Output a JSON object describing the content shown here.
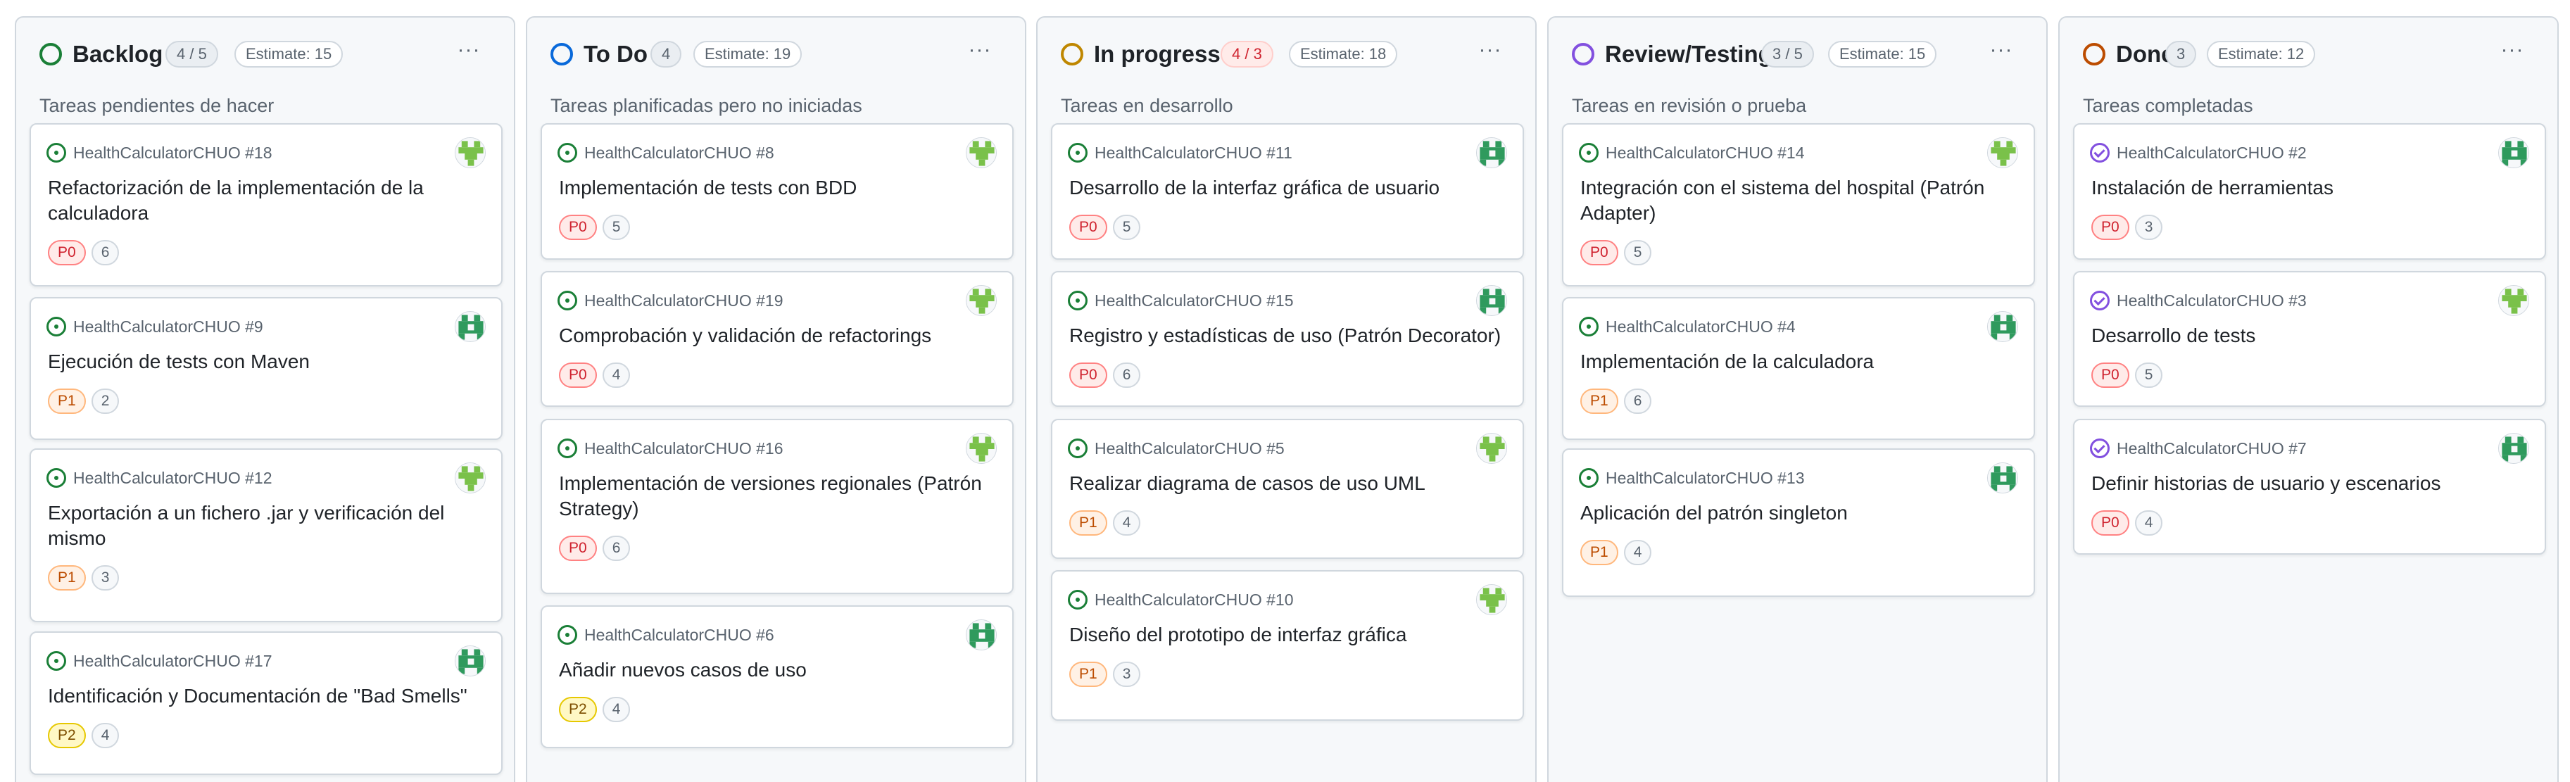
{
  "columns": [
    {
      "title": "Backlog",
      "count": "4 / 5",
      "estimate": "Estimate: 15",
      "description": "Tareas pendientes de hacer",
      "status_color": "#1a7f37",
      "count_style": "plain",
      "cards": [
        {
          "ref": "HealthCalculatorCHUO #18",
          "title": "Refactorización de la implementación de la calculadora",
          "priority": "P0",
          "estimate": "6",
          "state": "open",
          "avatar": "green-tree-avatar"
        },
        {
          "ref": "HealthCalculatorCHUO #9",
          "title": "Ejecución de tests con Maven",
          "priority": "P1",
          "estimate": "2",
          "state": "open",
          "avatar": "green-block-avatar"
        },
        {
          "ref": "HealthCalculatorCHUO #12",
          "title": "Exportación a un fichero .jar y verificación del mismo",
          "priority": "P1",
          "estimate": "3",
          "state": "open",
          "avatar": "green-tree-avatar"
        },
        {
          "ref": "HealthCalculatorCHUO #17",
          "title": "Identificación y Documentación de \"Bad Smells\"",
          "priority": "P2",
          "estimate": "4",
          "state": "open",
          "avatar": "green-block-avatar"
        }
      ]
    },
    {
      "title": "To Do",
      "count": "4",
      "estimate": "Estimate: 19",
      "description": "Tareas planificadas pero no iniciadas",
      "status_color": "#0969da",
      "count_style": "plain",
      "cards": [
        {
          "ref": "HealthCalculatorCHUO #8",
          "title": "Implementación de tests con BDD",
          "priority": "P0",
          "estimate": "5",
          "state": "open",
          "avatar": "green-tree-avatar"
        },
        {
          "ref": "HealthCalculatorCHUO #19",
          "title": "Comprobación y validación de refactorings",
          "priority": "P0",
          "estimate": "4",
          "state": "open",
          "avatar": "green-tree-avatar"
        },
        {
          "ref": "HealthCalculatorCHUO #16",
          "title": "Implementación de versiones regionales (Patrón Strategy)",
          "priority": "P0",
          "estimate": "6",
          "state": "open",
          "avatar": "green-tree-avatar"
        },
        {
          "ref": "HealthCalculatorCHUO #6",
          "title": "Añadir nuevos casos de uso",
          "priority": "P2",
          "estimate": "4",
          "state": "open",
          "avatar": "green-block-avatar"
        }
      ]
    },
    {
      "title": "In progress",
      "count": "4 / 3",
      "estimate": "Estimate: 18",
      "description": "Tareas en desarrollo",
      "status_color": "#bf8700",
      "count_style": "over",
      "cards": [
        {
          "ref": "HealthCalculatorCHUO #11",
          "title": "Desarrollo de la interfaz gráfica de usuario",
          "priority": "P0",
          "estimate": "5",
          "state": "open",
          "avatar": "green-block-avatar"
        },
        {
          "ref": "HealthCalculatorCHUO #15",
          "title": "Registro y estadísticas de uso (Patrón Decorator)",
          "priority": "P0",
          "estimate": "6",
          "state": "open",
          "avatar": "green-block-avatar"
        },
        {
          "ref": "HealthCalculatorCHUO #5",
          "title": "Realizar diagrama de casos de uso UML",
          "priority": "P1",
          "estimate": "4",
          "state": "open",
          "avatar": "green-tree-avatar"
        },
        {
          "ref": "HealthCalculatorCHUO #10",
          "title": "Diseño del prototipo de interfaz gráfica",
          "priority": "P1",
          "estimate": "3",
          "state": "open",
          "avatar": "green-tree-avatar"
        }
      ]
    },
    {
      "title": "Review/Testing",
      "count": "3 / 5",
      "estimate": "Estimate: 15",
      "description": "Tareas en revisión o prueba",
      "status_color": "#8250df",
      "count_style": "plain",
      "cards": [
        {
          "ref": "HealthCalculatorCHUO #14",
          "title": "Integración con el sistema del hospital (Patrón Adapter)",
          "priority": "P0",
          "estimate": "5",
          "state": "open",
          "avatar": "green-tree-avatar"
        },
        {
          "ref": "HealthCalculatorCHUO #4",
          "title": "Implementación de la calculadora",
          "priority": "P1",
          "estimate": "6",
          "state": "open",
          "avatar": "green-block-avatar"
        },
        {
          "ref": "HealthCalculatorCHUO #13",
          "title": "Aplicación del patrón singleton",
          "priority": "P1",
          "estimate": "4",
          "state": "open",
          "avatar": "green-block-avatar"
        }
      ]
    },
    {
      "title": "Done",
      "count": "3",
      "estimate": "Estimate: 12",
      "description": "Tareas completadas",
      "status_color": "#bc4c00",
      "count_style": "plain",
      "cards": [
        {
          "ref": "HealthCalculatorCHUO #2",
          "title": "Instalación de herramientas",
          "priority": "P0",
          "estimate": "3",
          "state": "closed",
          "avatar": "green-block-avatar"
        },
        {
          "ref": "HealthCalculatorCHUO #3",
          "title": "Desarrollo de tests",
          "priority": "P0",
          "estimate": "5",
          "state": "closed",
          "avatar": "green-tree-avatar"
        },
        {
          "ref": "HealthCalculatorCHUO #7",
          "title": "Definir historias de usuario y escenarios",
          "priority": "P0",
          "estimate": "4",
          "state": "closed",
          "avatar": "green-block-avatar"
        }
      ]
    }
  ],
  "icons": {
    "more_options": "more-horizontal-icon",
    "open_issue": "issue-open-icon",
    "closed_issue": "issue-closed-icon"
  },
  "more_label": "···"
}
